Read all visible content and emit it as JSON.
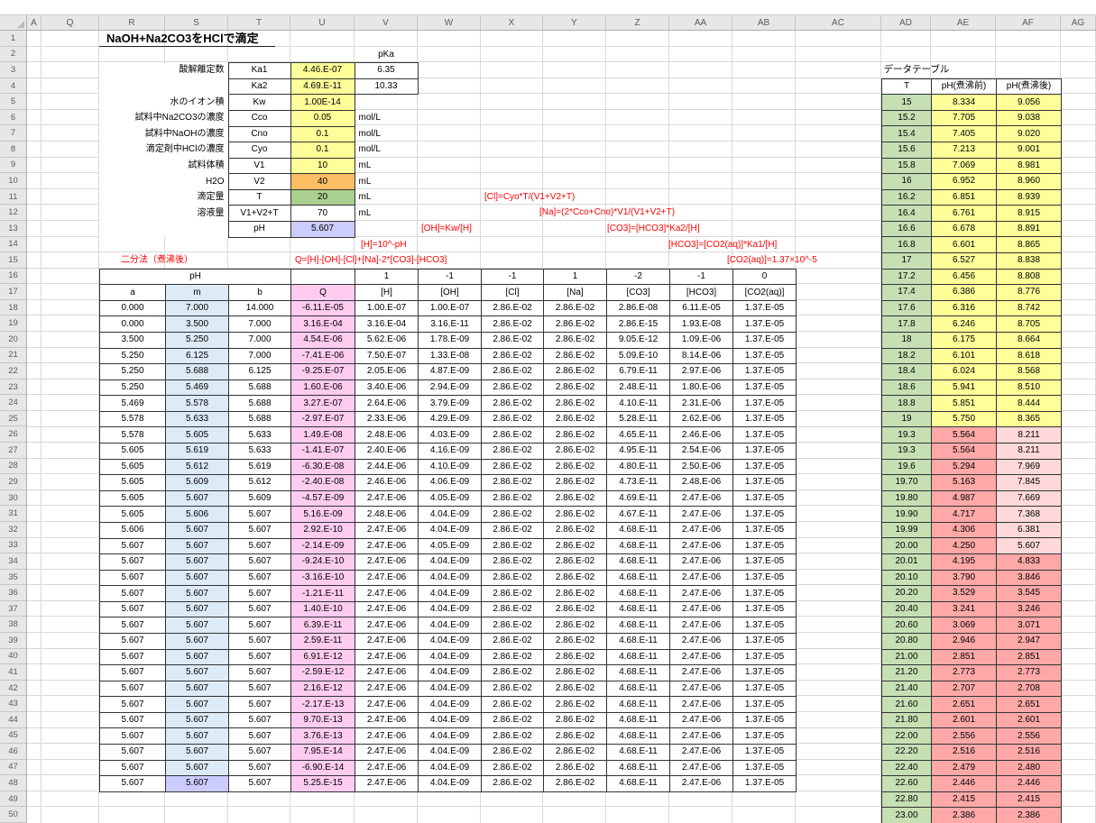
{
  "sheet": {
    "column_letters": [
      "A",
      "Q",
      "R",
      "S",
      "T",
      "U",
      "V",
      "W",
      "X",
      "Y",
      "Z",
      "AA",
      "AB",
      "AC",
      "AD",
      "AE",
      "AF",
      "AG"
    ],
    "row_count": 50
  },
  "title": "NaOH+Na2CO3をHClで滴定",
  "colors": {
    "yellow": "#FFFF99",
    "orange": "#FBBE62",
    "green_param": "#A9D08E",
    "green": "#C6E0B4",
    "white": "#FFFFFF",
    "purple": "#CCCCFF",
    "blue": "#DDEBF7",
    "pink": "#FFCCF0",
    "salmon": "#FFA8A8",
    "lightpink": "#FFD9D9",
    "red_text": "#FF0000"
  },
  "params": {
    "pka_header": "pKa",
    "rows": [
      {
        "label": "酸解離定数",
        "name": "Ka1",
        "value": "4.46.E-07",
        "color": "yellow",
        "pka": "6.35"
      },
      {
        "label": "",
        "name": "Ka2",
        "value": "4.69.E-11",
        "color": "yellow",
        "pka": "10.33"
      },
      {
        "label": "水のイオン積",
        "name": "Kw",
        "value": "1.00E-14",
        "color": "yellow"
      },
      {
        "label": "試料中Na2CO3の濃度",
        "name": "Cco",
        "value": "0.05",
        "color": "yellow",
        "unit": "mol/L"
      },
      {
        "label": "試料中NaOHの濃度",
        "name": "Cno",
        "value": "0.1",
        "color": "yellow",
        "unit": "mol/L"
      },
      {
        "label": "滴定剤中HClの濃度",
        "name": "Cyo",
        "value": "0.1",
        "color": "yellow",
        "unit": "mol/L"
      },
      {
        "label": "試料体積",
        "name": "V1",
        "value": "10",
        "color": "yellow",
        "unit": "mL"
      },
      {
        "label": "H2O",
        "name": "V2",
        "value": "40",
        "color": "orange",
        "unit": "mL"
      },
      {
        "label": "滴定量",
        "name": "T",
        "value": "20",
        "color": "green_param",
        "unit": "mL"
      },
      {
        "label": "溶液量",
        "name": "V1+V2+T",
        "value": "70",
        "color": "white",
        "unit": "mL"
      },
      {
        "label": "",
        "name": "pH",
        "value": "5.607",
        "color": "purple"
      }
    ]
  },
  "formulas": {
    "cl": "[Cl]=Cyo*T/(V1+V2+T)",
    "na": "[Na]=(2*Cco+Cno)*V1/(V1+V2+T)",
    "oh": "[OH]=Kw/[H]",
    "co3": "[CO3]=[HCO3]*Ka2/[H]",
    "h": "[H]=10^-pH",
    "hco3": "[HCO3]=[CO2(aq)]*Ka1/[H]",
    "bisection_label": "二分法（煮沸後）",
    "q": "Q=[H]-[OH]-[Cl]+[Na]-2*[CO3]-[HCO3]",
    "co2": "[CO2(aq)]=1.37×10^-5"
  },
  "bisection": {
    "ph_header": "pH",
    "coefficients": [
      "1",
      "-1",
      "-1",
      "1",
      "-2",
      "-1",
      "0"
    ],
    "headers": [
      "a",
      "m",
      "b",
      "Q",
      "[H]",
      "[OH]",
      "[Cl]",
      "[Na]",
      "[CO3]",
      "[HCO3]",
      "[CO2(aq)]"
    ],
    "rows": [
      [
        "0.000",
        "7.000",
        "14.000",
        "-6.11.E-05",
        "1.00.E-07",
        "1.00.E-07",
        "2.86.E-02",
        "2.86.E-02",
        "2.86.E-08",
        "6.11.E-05",
        "1.37.E-05"
      ],
      [
        "0.000",
        "3.500",
        "7.000",
        "3.16.E-04",
        "3.16.E-04",
        "3.16.E-11",
        "2.86.E-02",
        "2.86.E-02",
        "2.86.E-15",
        "1.93.E-08",
        "1.37.E-05"
      ],
      [
        "3.500",
        "5.250",
        "7.000",
        "4.54.E-06",
        "5.62.E-06",
        "1.78.E-09",
        "2.86.E-02",
        "2.86.E-02",
        "9.05.E-12",
        "1.09.E-06",
        "1.37.E-05"
      ],
      [
        "5.250",
        "6.125",
        "7.000",
        "-7.41.E-06",
        "7.50.E-07",
        "1.33.E-08",
        "2.86.E-02",
        "2.86.E-02",
        "5.09.E-10",
        "8.14.E-06",
        "1.37.E-05"
      ],
      [
        "5.250",
        "5.688",
        "6.125",
        "-9.25.E-07",
        "2.05.E-06",
        "4.87.E-09",
        "2.86.E-02",
        "2.86.E-02",
        "6.79.E-11",
        "2.97.E-06",
        "1.37.E-05"
      ],
      [
        "5.250",
        "5.469",
        "5.688",
        "1.60.E-06",
        "3.40.E-06",
        "2.94.E-09",
        "2.86.E-02",
        "2.86.E-02",
        "2.48.E-11",
        "1.80.E-06",
        "1.37.E-05"
      ],
      [
        "5.469",
        "5.578",
        "5.688",
        "3.27.E-07",
        "2.64.E-06",
        "3.79.E-09",
        "2.86.E-02",
        "2.86.E-02",
        "4.10.E-11",
        "2.31.E-06",
        "1.37.E-05"
      ],
      [
        "5.578",
        "5.633",
        "5.688",
        "-2.97.E-07",
        "2.33.E-06",
        "4.29.E-09",
        "2.86.E-02",
        "2.86.E-02",
        "5.28.E-11",
        "2.62.E-06",
        "1.37.E-05"
      ],
      [
        "5.578",
        "5.605",
        "5.633",
        "1.49.E-08",
        "2.48.E-06",
        "4.03.E-09",
        "2.86.E-02",
        "2.86.E-02",
        "4.65.E-11",
        "2.46.E-06",
        "1.37.E-05"
      ],
      [
        "5.605",
        "5.619",
        "5.633",
        "-1.41.E-07",
        "2.40.E-06",
        "4.16.E-09",
        "2.86.E-02",
        "2.86.E-02",
        "4.95.E-11",
        "2.54.E-06",
        "1.37.E-05"
      ],
      [
        "5.605",
        "5.612",
        "5.619",
        "-6.30.E-08",
        "2.44.E-06",
        "4.10.E-09",
        "2.86.E-02",
        "2.86.E-02",
        "4.80.E-11",
        "2.50.E-06",
        "1.37.E-05"
      ],
      [
        "5.605",
        "5.609",
        "5.612",
        "-2.40.E-08",
        "2.46.E-06",
        "4.06.E-09",
        "2.86.E-02",
        "2.86.E-02",
        "4.73.E-11",
        "2.48.E-06",
        "1.37.E-05"
      ],
      [
        "5.605",
        "5.607",
        "5.609",
        "-4.57.E-09",
        "2.47.E-06",
        "4.05.E-09",
        "2.86.E-02",
        "2.86.E-02",
        "4.69.E-11",
        "2.47.E-06",
        "1.37.E-05"
      ],
      [
        "5.605",
        "5.606",
        "5.607",
        "5.16.E-09",
        "2.48.E-06",
        "4.04.E-09",
        "2.86.E-02",
        "2.86.E-02",
        "4.67.E-11",
        "2.47.E-06",
        "1.37.E-05"
      ],
      [
        "5.606",
        "5.607",
        "5.607",
        "2.92.E-10",
        "2.47.E-06",
        "4.04.E-09",
        "2.86.E-02",
        "2.86.E-02",
        "4.68.E-11",
        "2.47.E-06",
        "1.37.E-05"
      ],
      [
        "5.607",
        "5.607",
        "5.607",
        "-2.14.E-09",
        "2.47.E-06",
        "4.05.E-09",
        "2.86.E-02",
        "2.86.E-02",
        "4.68.E-11",
        "2.47.E-06",
        "1.37.E-05"
      ],
      [
        "5.607",
        "5.607",
        "5.607",
        "-9.24.E-10",
        "2.47.E-06",
        "4.04.E-09",
        "2.86.E-02",
        "2.86.E-02",
        "4.68.E-11",
        "2.47.E-06",
        "1.37.E-05"
      ],
      [
        "5.607",
        "5.607",
        "5.607",
        "-3.16.E-10",
        "2.47.E-06",
        "4.04.E-09",
        "2.86.E-02",
        "2.86.E-02",
        "4.68.E-11",
        "2.47.E-06",
        "1.37.E-05"
      ],
      [
        "5.607",
        "5.607",
        "5.607",
        "-1.21.E-11",
        "2.47.E-06",
        "4.04.E-09",
        "2.86.E-02",
        "2.86.E-02",
        "4.68.E-11",
        "2.47.E-06",
        "1.37.E-05"
      ],
      [
        "5.607",
        "5.607",
        "5.607",
        "1.40.E-10",
        "2.47.E-06",
        "4.04.E-09",
        "2.86.E-02",
        "2.86.E-02",
        "4.68.E-11",
        "2.47.E-06",
        "1.37.E-05"
      ],
      [
        "5.607",
        "5.607",
        "5.607",
        "6.39.E-11",
        "2.47.E-06",
        "4.04.E-09",
        "2.86.E-02",
        "2.86.E-02",
        "4.68.E-11",
        "2.47.E-06",
        "1.37.E-05"
      ],
      [
        "5.607",
        "5.607",
        "5.607",
        "2.59.E-11",
        "2.47.E-06",
        "4.04.E-09",
        "2.86.E-02",
        "2.86.E-02",
        "4.68.E-11",
        "2.47.E-06",
        "1.37.E-05"
      ],
      [
        "5.607",
        "5.607",
        "5.607",
        "6.91.E-12",
        "2.47.E-06",
        "4.04.E-09",
        "2.86.E-02",
        "2.86.E-02",
        "4.68.E-11",
        "2.47.E-06",
        "1.37.E-05"
      ],
      [
        "5.607",
        "5.607",
        "5.607",
        "-2.59.E-12",
        "2.47.E-06",
        "4.04.E-09",
        "2.86.E-02",
        "2.86.E-02",
        "4.68.E-11",
        "2.47.E-06",
        "1.37.E-05"
      ],
      [
        "5.607",
        "5.607",
        "5.607",
        "2.16.E-12",
        "2.47.E-06",
        "4.04.E-09",
        "2.86.E-02",
        "2.86.E-02",
        "4.68.E-11",
        "2.47.E-06",
        "1.37.E-05"
      ],
      [
        "5.607",
        "5.607",
        "5.607",
        "-2.17.E-13",
        "2.47.E-06",
        "4.04.E-09",
        "2.86.E-02",
        "2.86.E-02",
        "4.68.E-11",
        "2.47.E-06",
        "1.37.E-05"
      ],
      [
        "5.607",
        "5.607",
        "5.607",
        "9.70.E-13",
        "2.47.E-06",
        "4.04.E-09",
        "2.86.E-02",
        "2.86.E-02",
        "4.68.E-11",
        "2.47.E-06",
        "1.37.E-05"
      ],
      [
        "5.607",
        "5.607",
        "5.607",
        "3.76.E-13",
        "2.47.E-06",
        "4.04.E-09",
        "2.86.E-02",
        "2.86.E-02",
        "4.68.E-11",
        "2.47.E-06",
        "1.37.E-05"
      ],
      [
        "5.607",
        "5.607",
        "5.607",
        "7.95.E-14",
        "2.47.E-06",
        "4.04.E-09",
        "2.86.E-02",
        "2.86.E-02",
        "4.68.E-11",
        "2.47.E-06",
        "1.37.E-05"
      ],
      [
        "5.607",
        "5.607",
        "5.607",
        "-6.90.E-14",
        "2.47.E-06",
        "4.04.E-09",
        "2.86.E-02",
        "2.86.E-02",
        "4.68.E-11",
        "2.47.E-06",
        "1.37.E-05"
      ],
      [
        "5.607",
        "5.607",
        "5.607",
        "5.25.E-15",
        "2.47.E-06",
        "4.04.E-09",
        "2.86.E-02",
        "2.86.E-02",
        "4.68.E-11",
        "2.47.E-06",
        "1.37.E-05"
      ]
    ]
  },
  "data_table": {
    "title": "データテーブル",
    "headers": [
      "T",
      "pH(煮沸前)",
      "pH(煮沸後)"
    ],
    "rows": [
      [
        "15",
        "8.334",
        "9.056",
        "y",
        "y"
      ],
      [
        "15.2",
        "7.705",
        "9.038",
        "y",
        "y"
      ],
      [
        "15.4",
        "7.405",
        "9.020",
        "y",
        "y"
      ],
      [
        "15.6",
        "7.213",
        "9.001",
        "y",
        "y"
      ],
      [
        "15.8",
        "7.069",
        "8.981",
        "y",
        "y"
      ],
      [
        "16",
        "6.952",
        "8.960",
        "y",
        "y"
      ],
      [
        "16.2",
        "6.851",
        "8.939",
        "y",
        "y"
      ],
      [
        "16.4",
        "6.761",
        "8.915",
        "y",
        "y"
      ],
      [
        "16.6",
        "6.678",
        "8.891",
        "y",
        "y"
      ],
      [
        "16.8",
        "6.601",
        "8.865",
        "y",
        "y"
      ],
      [
        "17",
        "6.527",
        "8.838",
        "y",
        "y"
      ],
      [
        "17.2",
        "6.456",
        "8.808",
        "y",
        "y"
      ],
      [
        "17.4",
        "6.386",
        "8.776",
        "y",
        "y"
      ],
      [
        "17.6",
        "6.316",
        "8.742",
        "y",
        "y"
      ],
      [
        "17.8",
        "6.246",
        "8.705",
        "y",
        "y"
      ],
      [
        "18",
        "6.175",
        "8.664",
        "y",
        "y"
      ],
      [
        "18.2",
        "6.101",
        "8.618",
        "y",
        "y"
      ],
      [
        "18.4",
        "6.024",
        "8.568",
        "y",
        "y"
      ],
      [
        "18.6",
        "5.941",
        "8.510",
        "y",
        "y"
      ],
      [
        "18.8",
        "5.851",
        "8.444",
        "y",
        "y"
      ],
      [
        "19",
        "5.750",
        "8.365",
        "y",
        "y"
      ],
      [
        "19.3",
        "5.564",
        "8.211",
        "s",
        "l"
      ],
      [
        "19.3",
        "5.564",
        "8.211",
        "s",
        "l"
      ],
      [
        "19.6",
        "5.294",
        "7.969",
        "s",
        "l"
      ],
      [
        "19.70",
        "5.163",
        "7.845",
        "s",
        "l"
      ],
      [
        "19.80",
        "4.987",
        "7.669",
        "s",
        "l"
      ],
      [
        "19.90",
        "4.717",
        "7.368",
        "s",
        "l"
      ],
      [
        "19.99",
        "4.306",
        "6.381",
        "s",
        "l"
      ],
      [
        "20.00",
        "4.250",
        "5.607",
        "s",
        "l"
      ],
      [
        "20.01",
        "4.195",
        "4.833",
        "s",
        "s"
      ],
      [
        "20.10",
        "3.790",
        "3.846",
        "s",
        "s"
      ],
      [
        "20.20",
        "3.529",
        "3.545",
        "s",
        "s"
      ],
      [
        "20.40",
        "3.241",
        "3.246",
        "s",
        "s"
      ],
      [
        "20.60",
        "3.069",
        "3.071",
        "s",
        "s"
      ],
      [
        "20.80",
        "2.946",
        "2.947",
        "s",
        "s"
      ],
      [
        "21.00",
        "2.851",
        "2.851",
        "s",
        "s"
      ],
      [
        "21.20",
        "2.773",
        "2.773",
        "s",
        "s"
      ],
      [
        "21.40",
        "2.707",
        "2.708",
        "s",
        "s"
      ],
      [
        "21.60",
        "2.651",
        "2.651",
        "s",
        "s"
      ],
      [
        "21.80",
        "2.601",
        "2.601",
        "s",
        "s"
      ],
      [
        "22.00",
        "2.556",
        "2.556",
        "s",
        "s"
      ],
      [
        "22.20",
        "2.516",
        "2.516",
        "s",
        "s"
      ],
      [
        "22.40",
        "2.479",
        "2.480",
        "s",
        "s"
      ],
      [
        "22.60",
        "2.446",
        "2.446",
        "s",
        "s"
      ],
      [
        "22.80",
        "2.415",
        "2.415",
        "s",
        "s"
      ],
      [
        "23.00",
        "2.386",
        "2.386",
        "s",
        "s"
      ]
    ]
  }
}
